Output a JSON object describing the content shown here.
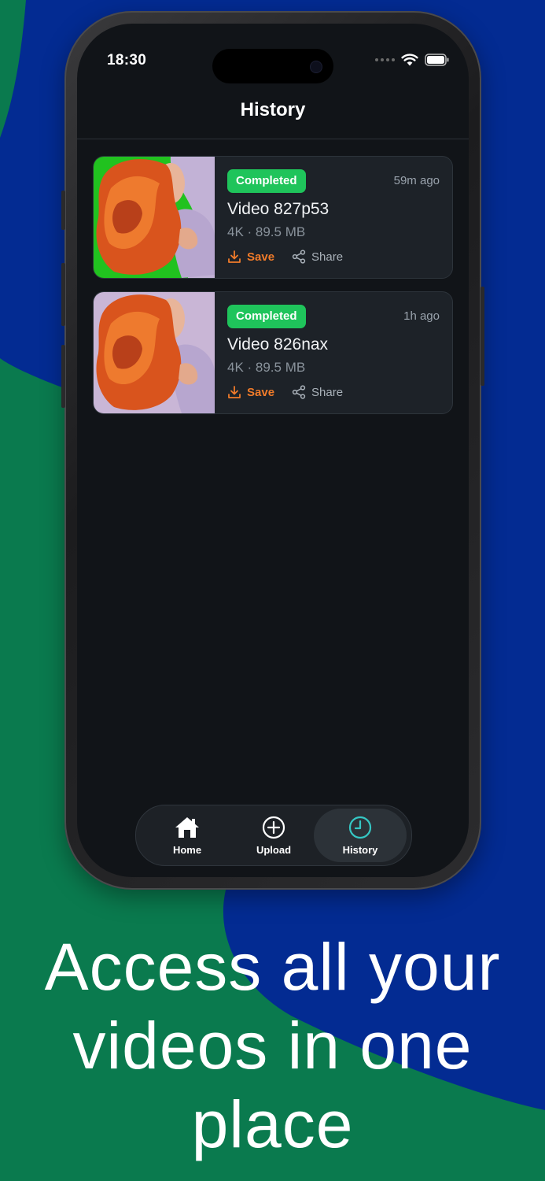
{
  "status_bar": {
    "time": "18:30"
  },
  "header": {
    "title": "History"
  },
  "history": [
    {
      "status": "Completed",
      "time_ago": "59m ago",
      "title": "Video 827p53",
      "meta": "4K · 89.5 MB",
      "save_label": "Save",
      "share_label": "Share",
      "thumb_bg": "#21c21f"
    },
    {
      "status": "Completed",
      "time_ago": "1h ago",
      "title": "Video 826nax",
      "meta": "4K · 89.5 MB",
      "save_label": "Save",
      "share_label": "Share",
      "thumb_bg": "#c9b6d6"
    }
  ],
  "tabbar": {
    "tabs": [
      {
        "label": "Home",
        "icon": "home-icon",
        "active": false
      },
      {
        "label": "Upload",
        "icon": "plus-circle-icon",
        "active": false
      },
      {
        "label": "History",
        "icon": "clock-icon",
        "active": true
      }
    ]
  },
  "caption": {
    "line1": "Access all your",
    "line2": "videos in one",
    "line3": "place"
  },
  "colors": {
    "background_green": "#0a7a4e",
    "background_blue": "#032b92",
    "badge_green": "#1fc45b",
    "save_orange": "#f07b2a",
    "history_teal": "#35c7c4"
  }
}
